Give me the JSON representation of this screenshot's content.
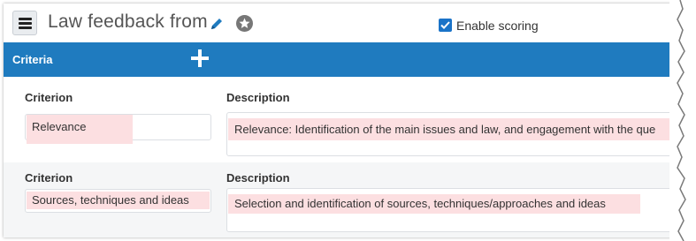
{
  "header": {
    "title": "Law feedback from",
    "enable_scoring_label": "Enable scoring",
    "enable_scoring_checked": true
  },
  "criteria_bar": {
    "label": "Criteria"
  },
  "rows": [
    {
      "criterion_header": "Criterion",
      "description_header": "Description",
      "criterion_value": "Relevance",
      "description_value": "Relevance: Identification of the main issues and law, and engagement with the que"
    },
    {
      "criterion_header": "Criterion",
      "description_header": "Description",
      "criterion_value": "Sources, techniques and ideas",
      "description_value": "Selection and identification of sources, techniques/approaches and ideas"
    }
  ],
  "colors": {
    "accent": "#1f7bbf",
    "highlight": "#fcdfe1",
    "checkbox": "#1a73c8"
  },
  "icons": [
    "menu-icon",
    "pencil-icon",
    "star-icon",
    "add-icon",
    "checkmark-icon"
  ]
}
